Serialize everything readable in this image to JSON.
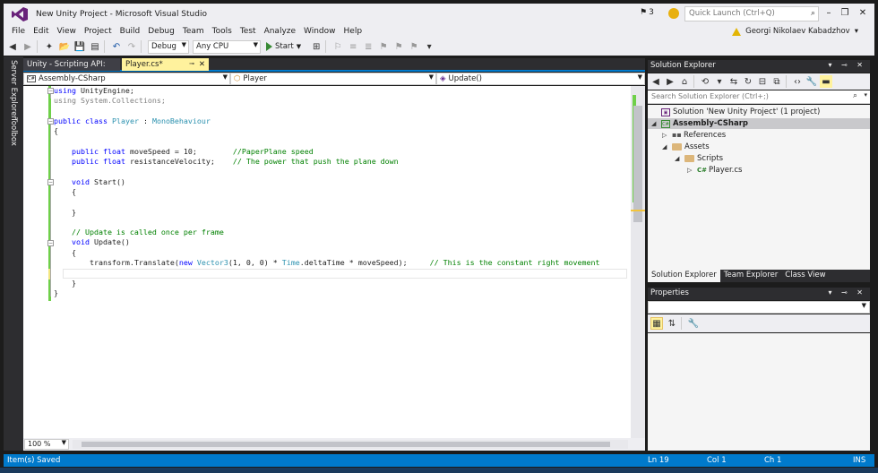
{
  "window": {
    "title": "New Unity Project - Microsoft Visual Studio",
    "notifications": "3",
    "quick_launch_placeholder": "Quick Launch (Ctrl+Q)",
    "user": "Georgi Nikolaev Kabadzhov"
  },
  "menu": [
    "File",
    "Edit",
    "View",
    "Project",
    "Build",
    "Debug",
    "Team",
    "Tools",
    "Test",
    "Analyze",
    "Window",
    "Help"
  ],
  "toolbar": {
    "configuration": "Debug",
    "platform": "Any CPU",
    "start_label": "Start"
  },
  "side_tabs": [
    "Server Explorer",
    "Toolbox"
  ],
  "editor_tabs": [
    {
      "label": "Unity - Scripting API:",
      "active": false
    },
    {
      "label": "Player.cs*",
      "active": true
    }
  ],
  "nav": {
    "project": "Assembly-CSharp",
    "class": "Player",
    "member": "Update()"
  },
  "code_lines": [
    [
      {
        "t": "using",
        "c": "kw"
      },
      {
        "t": " UnityEngine;",
        "c": ""
      }
    ],
    [
      {
        "t": "using System.Collections;",
        "c": "gray"
      }
    ],
    [],
    [
      {
        "t": "public",
        "c": "kw"
      },
      {
        "t": " ",
        "c": ""
      },
      {
        "t": "class",
        "c": "kw"
      },
      {
        "t": " ",
        "c": ""
      },
      {
        "t": "Player",
        "c": "ty"
      },
      {
        "t": " : ",
        "c": ""
      },
      {
        "t": "MonoBehaviour",
        "c": "ty"
      }
    ],
    [
      {
        "t": "{",
        "c": ""
      }
    ],
    [],
    [
      {
        "t": "    ",
        "c": ""
      },
      {
        "t": "public",
        "c": "kw"
      },
      {
        "t": " ",
        "c": ""
      },
      {
        "t": "float",
        "c": "kw"
      },
      {
        "t": " moveSpeed = 10;        ",
        "c": ""
      },
      {
        "t": "//PaperPlane speed",
        "c": "cm"
      }
    ],
    [
      {
        "t": "    ",
        "c": ""
      },
      {
        "t": "public",
        "c": "kw"
      },
      {
        "t": " ",
        "c": ""
      },
      {
        "t": "float",
        "c": "kw"
      },
      {
        "t": " resistanceVelocity;    ",
        "c": ""
      },
      {
        "t": "// The power that push the plane down",
        "c": "cm"
      }
    ],
    [],
    [
      {
        "t": "    ",
        "c": ""
      },
      {
        "t": "void",
        "c": "kw"
      },
      {
        "t": " Start()",
        "c": ""
      }
    ],
    [
      {
        "t": "    {",
        "c": ""
      }
    ],
    [],
    [
      {
        "t": "    }",
        "c": ""
      }
    ],
    [],
    [
      {
        "t": "    ",
        "c": ""
      },
      {
        "t": "// Update is called once per frame",
        "c": "cm"
      }
    ],
    [
      {
        "t": "    ",
        "c": ""
      },
      {
        "t": "void",
        "c": "kw"
      },
      {
        "t": " Update()",
        "c": ""
      }
    ],
    [
      {
        "t": "    {",
        "c": ""
      }
    ],
    [
      {
        "t": "        transform.Translate(",
        "c": ""
      },
      {
        "t": "new",
        "c": "kw"
      },
      {
        "t": " ",
        "c": ""
      },
      {
        "t": "Vector3",
        "c": "ty"
      },
      {
        "t": "(1, 0, 0) * ",
        "c": ""
      },
      {
        "t": "Time",
        "c": "ty"
      },
      {
        "t": ".deltaTime * moveSpeed);     ",
        "c": ""
      },
      {
        "t": "// This is the constant right movement",
        "c": "cm"
      }
    ],
    [],
    [
      {
        "t": "    }",
        "c": ""
      }
    ],
    [
      {
        "t": "}",
        "c": ""
      }
    ]
  ],
  "zoom": "100 %",
  "solution_explorer": {
    "title": "Solution Explorer",
    "search_placeholder": "Search Solution Explorer (Ctrl+;)",
    "items": [
      {
        "label": "Solution 'New Unity Project' (1 project)",
        "icon": "solution-icon",
        "level": 0
      },
      {
        "label": "Assembly-CSharp",
        "icon": "csharp-project-icon",
        "level": 1,
        "selected": true
      },
      {
        "label": "References",
        "icon": "references-icon",
        "level": 2
      },
      {
        "label": "Assets",
        "icon": "folder-icon",
        "level": 2
      },
      {
        "label": "Scripts",
        "icon": "folder-icon",
        "level": 3
      },
      {
        "label": "Player.cs",
        "icon": "csharp-file-icon",
        "level": 4
      }
    ],
    "bottom_tabs": [
      "Solution Explorer",
      "Team Explorer",
      "Class View"
    ]
  },
  "properties": {
    "title": "Properties"
  },
  "status": {
    "message": "Item(s) Saved",
    "line": "Ln 19",
    "col": "Col 1",
    "ch": "Ch 1",
    "mode": "INS"
  }
}
